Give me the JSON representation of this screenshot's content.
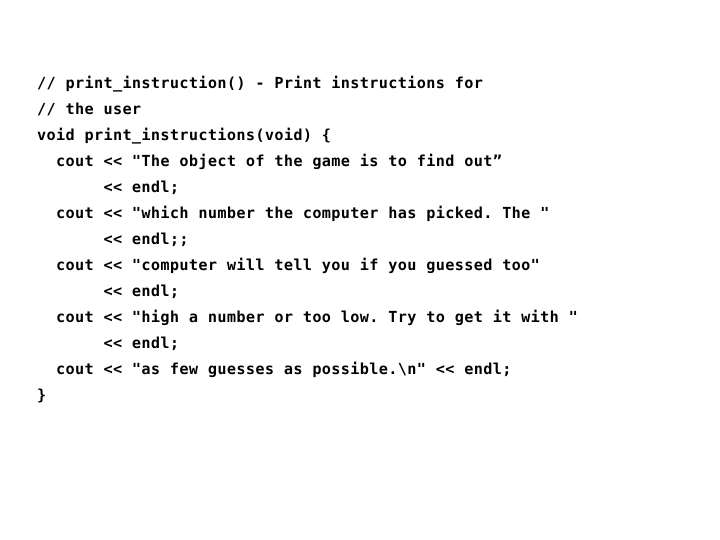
{
  "slide": {
    "background_color": "#ffffff",
    "text_color": "#000000",
    "language": "C++",
    "code_lines": [
      "// print_instruction() - Print instructions for",
      "// the user",
      "void print_instructions(void) {",
      "  cout << \"The object of the game is to find out”",
      "       << endl;",
      "  cout << \"which number the computer has picked. The \"",
      "       << endl;;",
      "  cout << \"computer will tell you if you guessed too\"",
      "       << endl;",
      "  cout << \"high a number or too low. Try to get it with \"",
      "       << endl;",
      "  cout << \"as few guesses as possible.\\n\" << endl;",
      "}"
    ]
  }
}
